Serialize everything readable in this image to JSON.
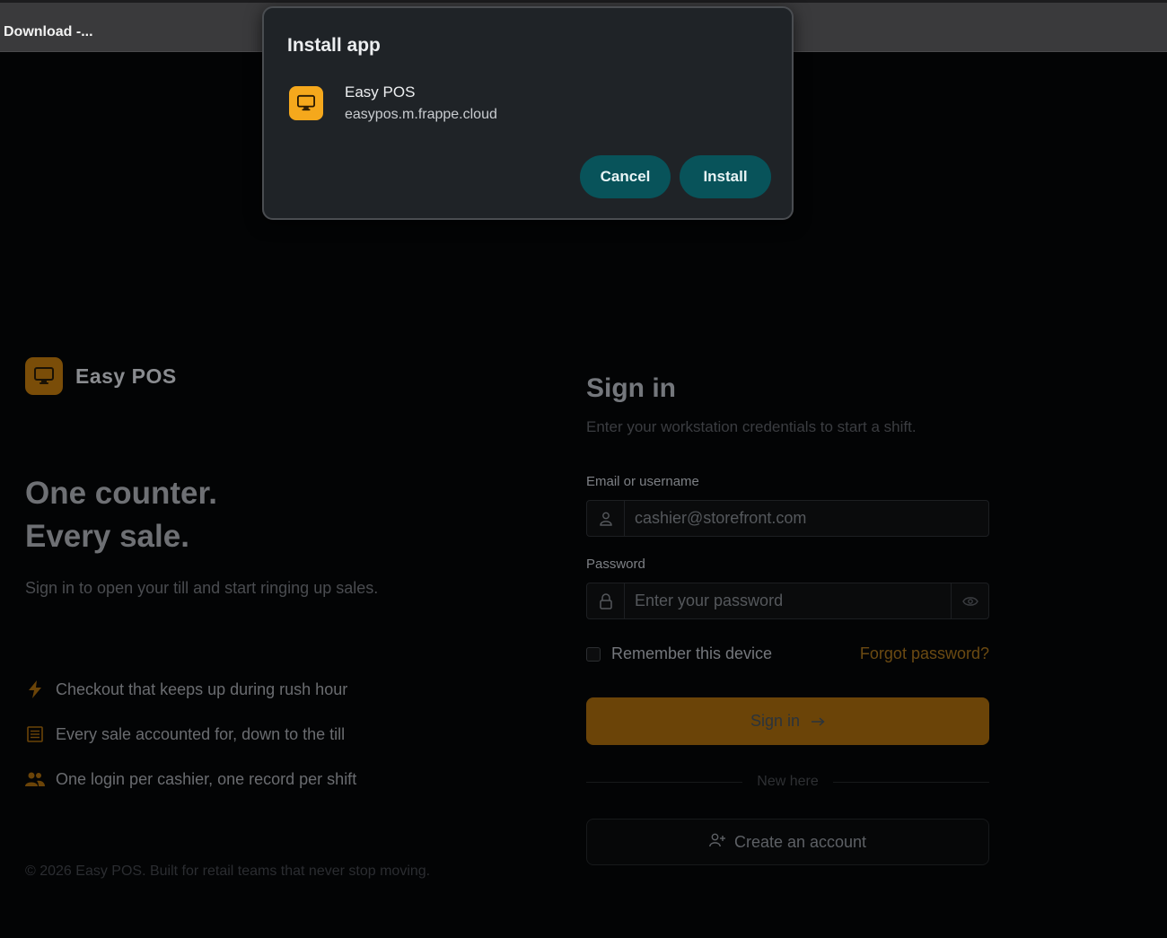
{
  "browser": {
    "tab_title": "Download -..."
  },
  "install_dialog": {
    "title": "Install app",
    "app_name": "Easy POS",
    "app_url": "easypos.m.frappe.cloud",
    "cancel_label": "Cancel",
    "install_label": "Install",
    "icon": "monitor-icon",
    "accent_color": "#f5a81c",
    "button_color": "#08535a"
  },
  "brand": {
    "name": "Easy POS",
    "icon": "monitor-icon"
  },
  "hero": {
    "headline_line1": "One counter.",
    "headline_line2": "Every sale.",
    "lead": "Sign in to open your till and start ringing up sales."
  },
  "features": [
    {
      "icon": "lightning-icon",
      "text": "Checkout that keeps up during rush hour"
    },
    {
      "icon": "receipt-icon",
      "text": "Every sale accounted for, down to the till"
    },
    {
      "icon": "users-icon",
      "text": "One login per cashier, one record per shift"
    }
  ],
  "footer": {
    "text": "© 2026 Easy POS. Built for retail teams that never stop moving."
  },
  "signin": {
    "title": "Sign in",
    "subtitle": "Enter your workstation credentials to start a shift.",
    "email_label": "Email or username",
    "email_placeholder": "cashier@storefront.com",
    "password_label": "Password",
    "password_placeholder": "Enter your password",
    "remember_label": "Remember this device",
    "forgot_label": "Forgot password?",
    "submit_label": "Sign in",
    "divider_label": "New here",
    "create_label": "Create an account"
  }
}
